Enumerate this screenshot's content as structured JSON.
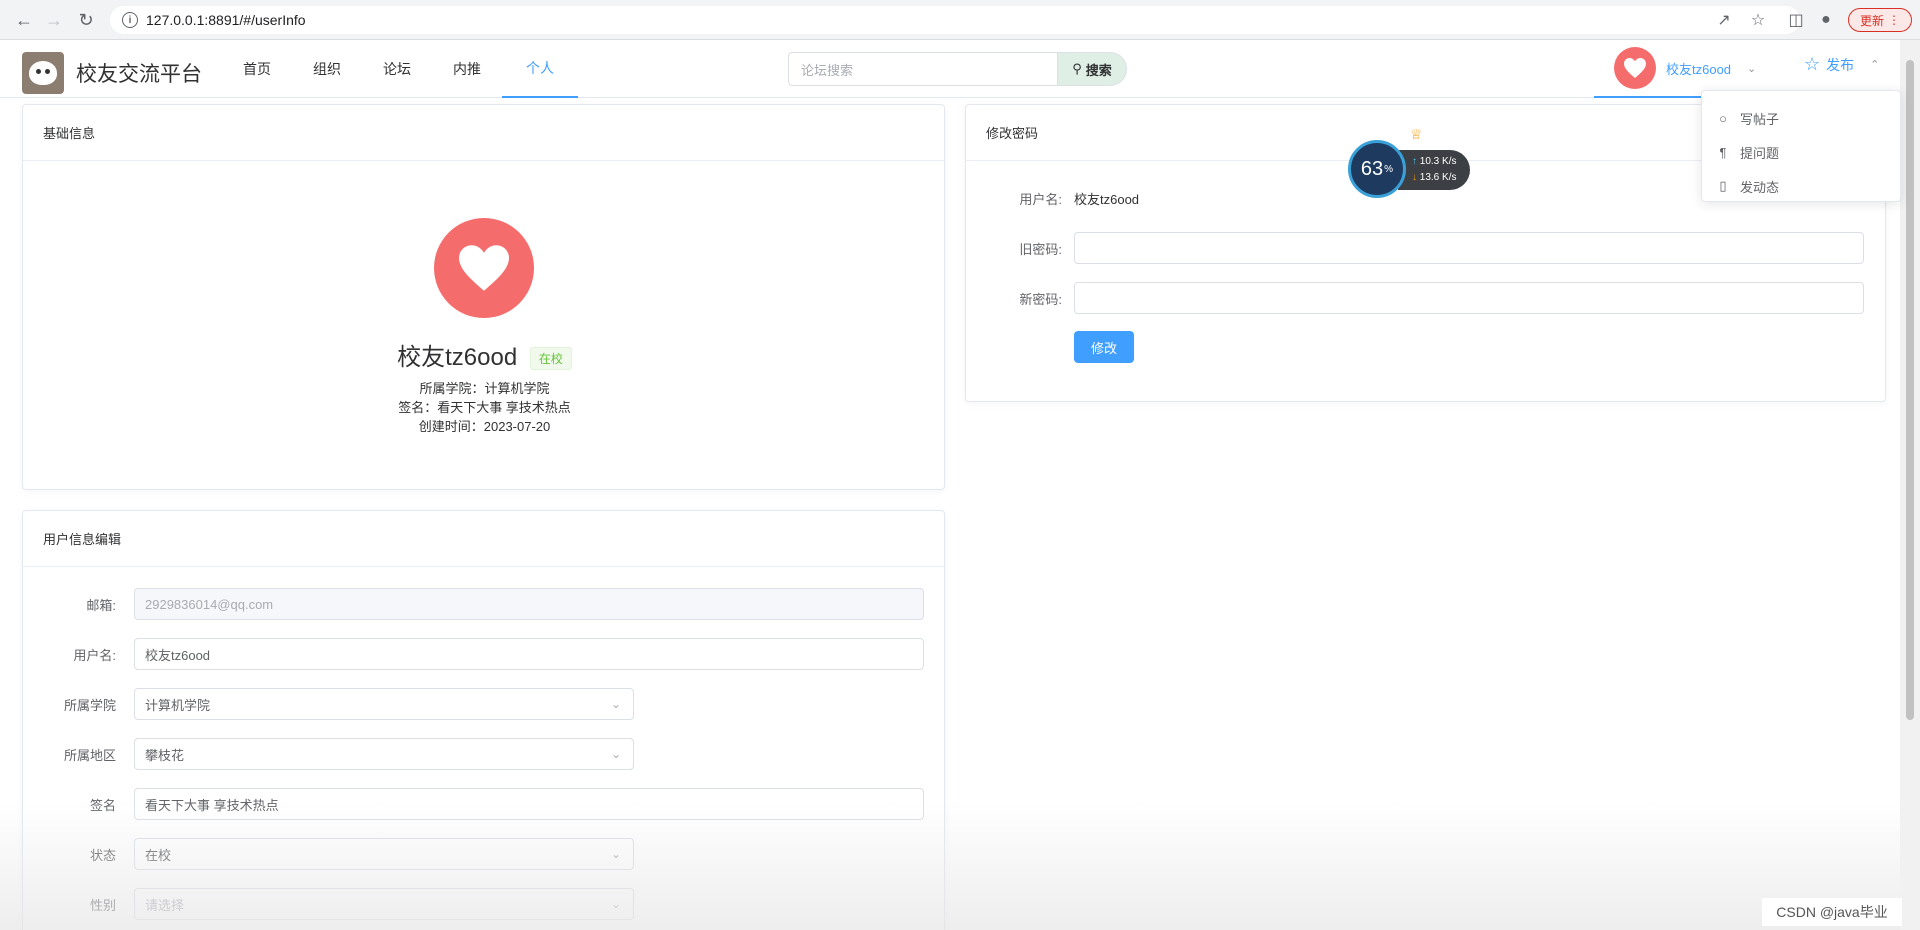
{
  "browser": {
    "url": "127.0.0.1:8891/#/userInfo",
    "update_label": "更新"
  },
  "header": {
    "site_title": "校友交流平台",
    "nav": [
      {
        "label": "首页"
      },
      {
        "label": "组织"
      },
      {
        "label": "论坛"
      },
      {
        "label": "内推"
      },
      {
        "label": "个人",
        "active": true
      }
    ],
    "search_placeholder": "论坛搜索",
    "search_button": "搜索",
    "user_name": "校友tz6ood",
    "publish_label": "发布"
  },
  "publish_menu": {
    "items": [
      {
        "label": "写帖子",
        "icon": "apple-icon"
      },
      {
        "label": "提问题",
        "icon": "fork-knife-icon"
      },
      {
        "label": "发动态",
        "icon": "cup-icon"
      }
    ]
  },
  "basic_info": {
    "title": "基础信息",
    "name": "校友tz6ood",
    "status": "在校",
    "college_line": "所属学院：计算机学院",
    "signature_line": "签名：看天下大事 享技术热点",
    "created_line": "创建时间：2023-07-20"
  },
  "password": {
    "title": "修改密码",
    "username_label": "用户名:",
    "username_value": "校友tz6ood",
    "old_label": "旧密码:",
    "new_label": "新密码:",
    "submit": "修改"
  },
  "edit": {
    "title": "用户信息编辑",
    "email_label": "邮箱:",
    "email_value": "2929836014@qq.com",
    "username_label": "用户名:",
    "username_value": "校友tz6ood",
    "college_label": "所属学院",
    "college_value": "计算机学院",
    "region_label": "所属地区",
    "region_value": "攀枝花",
    "signature_label": "签名",
    "signature_value": "看天下大事 享技术热点",
    "status_label": "状态",
    "status_value": "在校",
    "gender_label": "性别",
    "gender_placeholder": "请选择"
  },
  "speed_widget": {
    "percent": "63",
    "percent_unit": "%",
    "upload": "10.3",
    "download": "13.6",
    "rate_unit": "K/s"
  },
  "watermark": "CSDN @java毕业",
  "colors": {
    "primary": "#409eff",
    "avatar": "#f56c6c",
    "success": "#67c23a"
  }
}
